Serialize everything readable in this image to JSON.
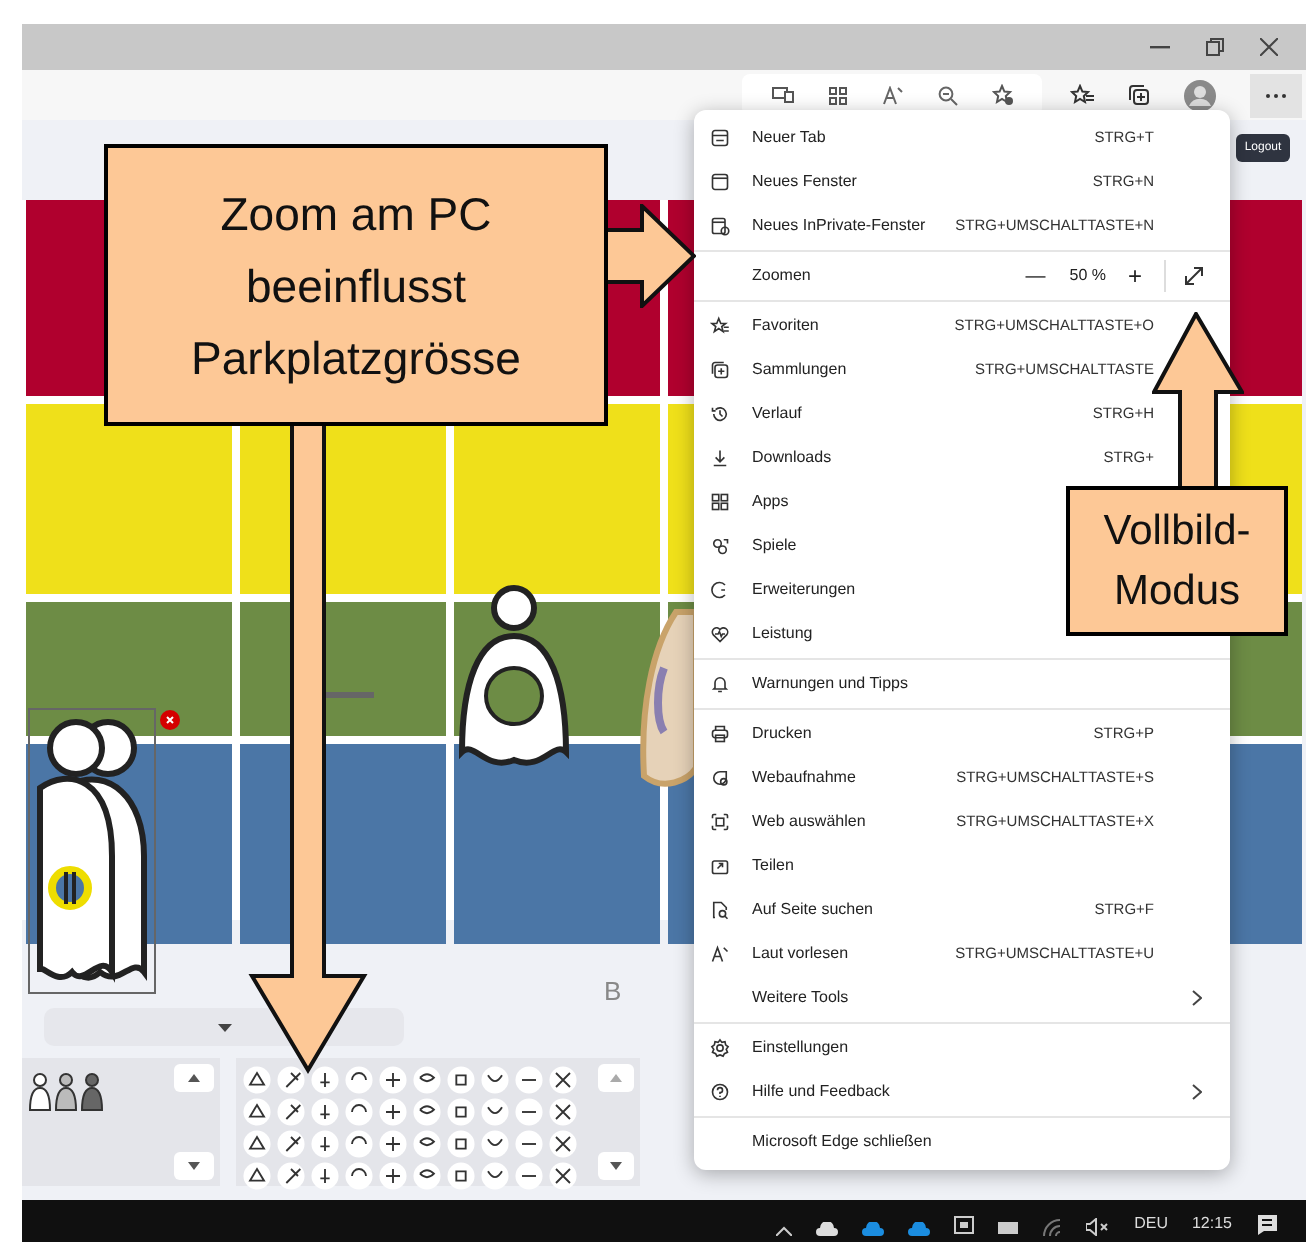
{
  "page": {
    "logout_button": "Logout",
    "board": {
      "rows": [
        {
          "color": "#b0002e"
        },
        {
          "color": "#efe01a"
        },
        {
          "color": "#6d8c45"
        },
        {
          "color": "#4b76a6"
        }
      ],
      "column_label": "B"
    }
  },
  "menu": {
    "sections": [
      {
        "items": [
          {
            "kind": "command",
            "label": "Neuer Tab",
            "shortcut": "STRG+T",
            "submenu": false
          },
          {
            "kind": "command",
            "label": "Neues Fenster",
            "shortcut": "STRG+N",
            "submenu": false
          },
          {
            "kind": "command",
            "label": "Neues InPrivate-Fenster",
            "shortcut": "STRG+UMSCHALTTASTE+N",
            "submenu": false
          }
        ]
      },
      {
        "items": [
          {
            "kind": "zoom",
            "label": "Zoomen",
            "minus": "—",
            "value": "50 %",
            "plus": "+"
          }
        ]
      },
      {
        "items": [
          {
            "kind": "command",
            "label": "Favoriten",
            "shortcut": "STRG+UMSCHALTTASTE+O",
            "submenu": false
          },
          {
            "kind": "command",
            "label": "Sammlungen",
            "shortcut": "STRG+UMSCHALTTASTE",
            "submenu": false
          },
          {
            "kind": "command",
            "label": "Verlauf",
            "shortcut": "STRG+H",
            "submenu": false
          },
          {
            "kind": "command",
            "label": "Downloads",
            "shortcut": "STRG+",
            "submenu": false
          },
          {
            "kind": "command",
            "label": "Apps",
            "submenu": false
          },
          {
            "kind": "command",
            "label": "Spiele",
            "submenu": false
          },
          {
            "kind": "command",
            "label": "Erweiterungen",
            "submenu": false
          },
          {
            "kind": "command",
            "label": "Leistung",
            "submenu": false
          }
        ]
      },
      {
        "items": [
          {
            "kind": "command",
            "label": "Warnungen und Tipps",
            "submenu": false
          }
        ]
      },
      {
        "items": [
          {
            "kind": "command",
            "label": "Drucken",
            "shortcut": "STRG+P",
            "submenu": false
          },
          {
            "kind": "command",
            "label": "Webaufnahme",
            "shortcut": "STRG+UMSCHALTTASTE+S",
            "submenu": false
          },
          {
            "kind": "command",
            "label": "Web auswählen",
            "shortcut": "STRG+UMSCHALTTASTE+X",
            "submenu": false
          },
          {
            "kind": "command",
            "label": "Teilen",
            "submenu": false
          },
          {
            "kind": "command",
            "label": "Auf Seite suchen",
            "shortcut": "STRG+F",
            "submenu": false
          },
          {
            "kind": "command",
            "label": "Laut vorlesen",
            "shortcut": "STRG+UMSCHALTTASTE+U",
            "submenu": false
          },
          {
            "kind": "command",
            "label": "Weitere Tools",
            "submenu": true
          }
        ]
      },
      {
        "items": [
          {
            "kind": "command",
            "label": "Einstellungen",
            "submenu": false
          },
          {
            "kind": "command",
            "label": "Hilfe und Feedback",
            "submenu": true
          }
        ]
      },
      {
        "items": [
          {
            "kind": "command",
            "label": "Microsoft Edge schließen",
            "submenu": false
          }
        ]
      }
    ]
  },
  "annotations": [
    {
      "text": "Zoom am PC\nbeeinflusst\nParkplatzgrösse"
    },
    {
      "text": "Vollbild-\nModus"
    }
  ],
  "taskbar": {
    "language": "DEU",
    "time": "12:15"
  }
}
